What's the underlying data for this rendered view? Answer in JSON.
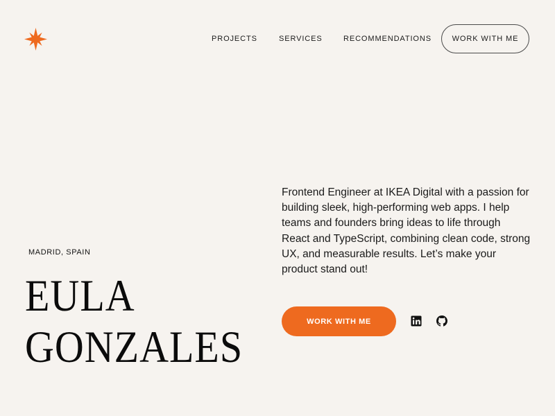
{
  "brand": {
    "logo_icon": "orange-star-icon",
    "accent_color": "#ee6a1f"
  },
  "nav": {
    "items": [
      {
        "label": "PROJECTS"
      },
      {
        "label": "SERVICES"
      },
      {
        "label": "RECOMMENDATIONS"
      }
    ],
    "cta_label": "WORK WITH ME"
  },
  "hero": {
    "location": "MADRID, SPAIN",
    "name_line1": "EULA",
    "name_line2": "GONZALES",
    "bio": "Frontend Engineer at IKEA Digital with a passion for building sleek, high-performing web apps. I help teams and founders bring ideas to life through React and TypeScript, combining clean code, strong UX, and measurable results. Let’s make your product stand out!",
    "cta_label": "WORK WITH ME",
    "social": [
      {
        "icon": "linkedin-icon"
      },
      {
        "icon": "github-icon"
      }
    ]
  }
}
